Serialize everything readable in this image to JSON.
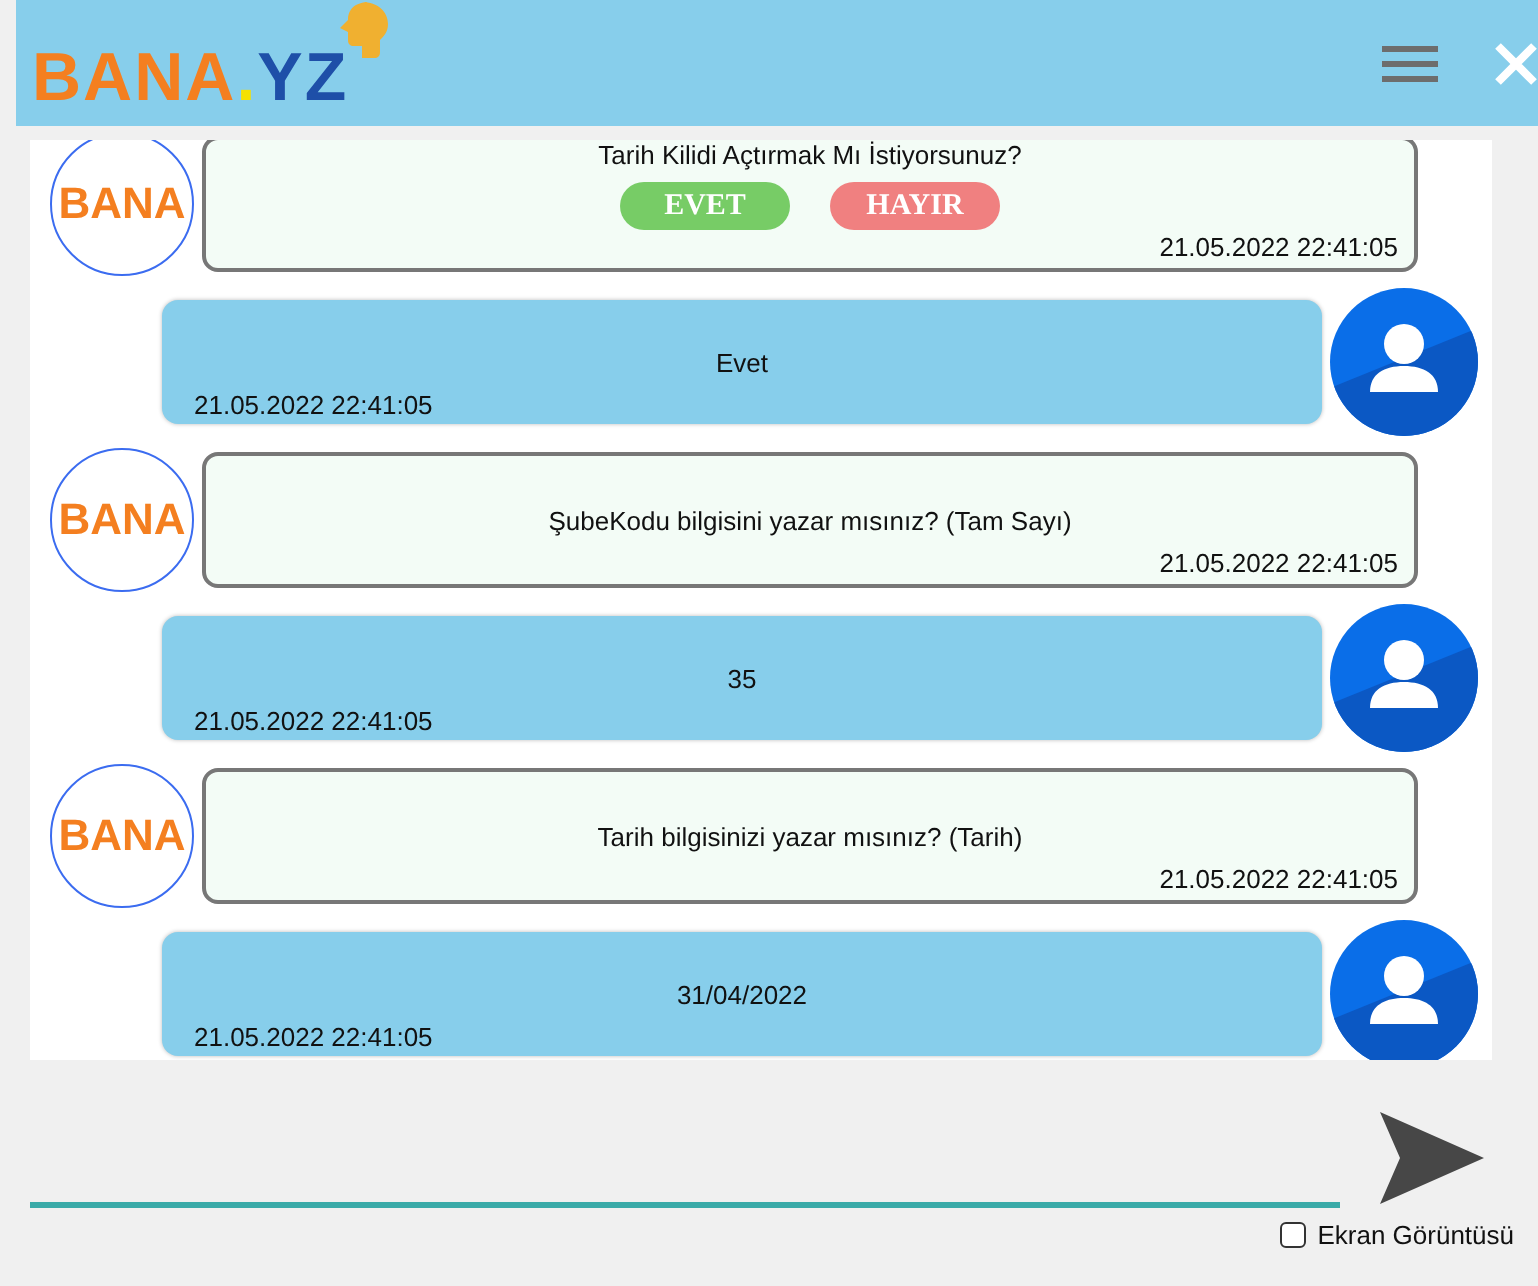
{
  "header": {
    "logo": {
      "part_1": "BANA",
      "dot": ".",
      "part_2": "YZ"
    }
  },
  "messages": [
    {
      "kind": "bot",
      "avatar": "BANA",
      "text": "Tarih Kilidi Açtırmak Mı İstiyorsunuz?",
      "buttons": [
        {
          "label": "EVET",
          "kind": "yes"
        },
        {
          "label": "HAYIR",
          "kind": "no"
        }
      ],
      "time": "21.05.2022 22:41:05"
    },
    {
      "kind": "user",
      "text": "Evet",
      "time": "21.05.2022 22:41:05"
    },
    {
      "kind": "bot",
      "avatar": "BANA",
      "text": "ŞubeKodu bilgisini yazar mısınız? (Tam Sayı)",
      "time": "21.05.2022 22:41:05"
    },
    {
      "kind": "user",
      "text": "35",
      "time": "21.05.2022 22:41:05"
    },
    {
      "kind": "bot",
      "avatar": "BANA",
      "text": "Tarih bilgisinizi yazar mısınız? (Tarih)",
      "time": "21.05.2022 22:41:05"
    },
    {
      "kind": "user",
      "text": "31/04/2022",
      "time": "21.05.2022 22:41:05"
    }
  ],
  "screenshot_option": {
    "label": "Ekran Görüntüsü",
    "checked": false
  }
}
